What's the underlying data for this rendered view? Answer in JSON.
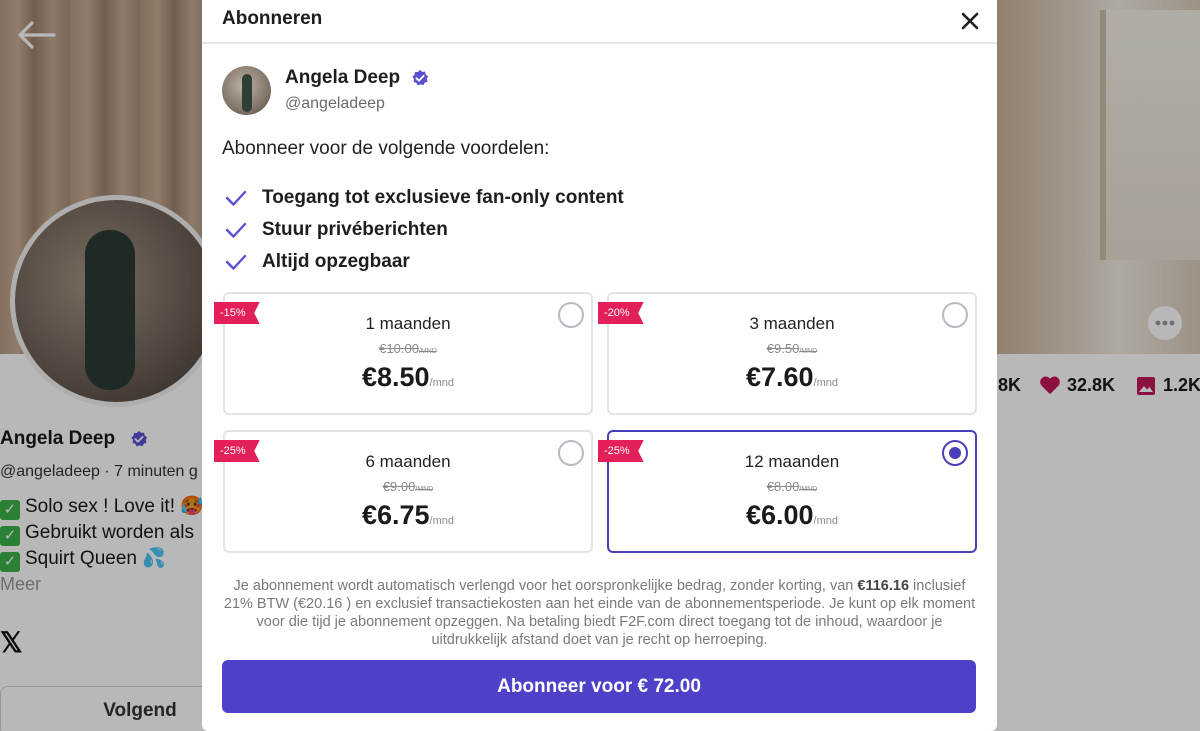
{
  "background": {
    "name": "Angela Deep",
    "handle": "@angeladeep · 7 minuten g",
    "bio": [
      "Solo sex ! Love it! 🥵",
      "Gebruikt worden als",
      "Squirt Queen 💦"
    ],
    "more_label": "Meer",
    "follow_label": "Volgend",
    "stats": {
      "first": "8K",
      "likes": "32.8K",
      "media": "1.2K"
    }
  },
  "modal": {
    "title": "Abonneren",
    "creator": {
      "name": "Angela Deep",
      "handle": "@angeladeep"
    },
    "intro": "Abonneer voor de volgende voordelen:",
    "benefits": [
      "Toegang tot exclusieve fan-only content",
      "Stuur privéberichten",
      "Altijd opzegbaar"
    ],
    "plans": [
      {
        "discount": "-15%",
        "duration": "1 maanden",
        "old_price": "€10.00",
        "old_unit": "/MND",
        "price": "€8.50",
        "unit": "/mnd",
        "selected": false
      },
      {
        "discount": "-20%",
        "duration": "3 maanden",
        "old_price": "€9.50",
        "old_unit": "/MND",
        "price": "€7.60",
        "unit": "/mnd",
        "selected": false
      },
      {
        "discount": "-25%",
        "duration": "6 maanden",
        "old_price": "€9.00",
        "old_unit": "/MND",
        "price": "€6.75",
        "unit": "/mnd",
        "selected": false
      },
      {
        "discount": "-25%",
        "duration": "12 maanden",
        "old_price": "€8.00",
        "old_unit": "/MND",
        "price": "€6.00",
        "unit": "/mnd",
        "selected": true
      }
    ],
    "disclaimer": {
      "part1": "Je abonnement wordt automatisch verlengd voor het oorspronkelijke bedrag, zonder korting, van ",
      "amount": "€116.16",
      "part2": " inclusief 21% BTW (€20.16 ) en exclusief transactiekosten aan het einde van de abonnementsperiode. Je kunt op elk moment voor die tijd je abonnement opzeggen. Na betaling biedt F2F.com direct toegang tot de inhoud, waardoor je uitdrukkelijk afstand doet van je recht op herroeping."
    },
    "subscribe_label": "Abonneer voor € 72.00"
  },
  "colors": {
    "accent": "#4e40c7",
    "badge": "#e3205a",
    "check": "#5a4fcf",
    "verified": "#5b4fd1"
  }
}
